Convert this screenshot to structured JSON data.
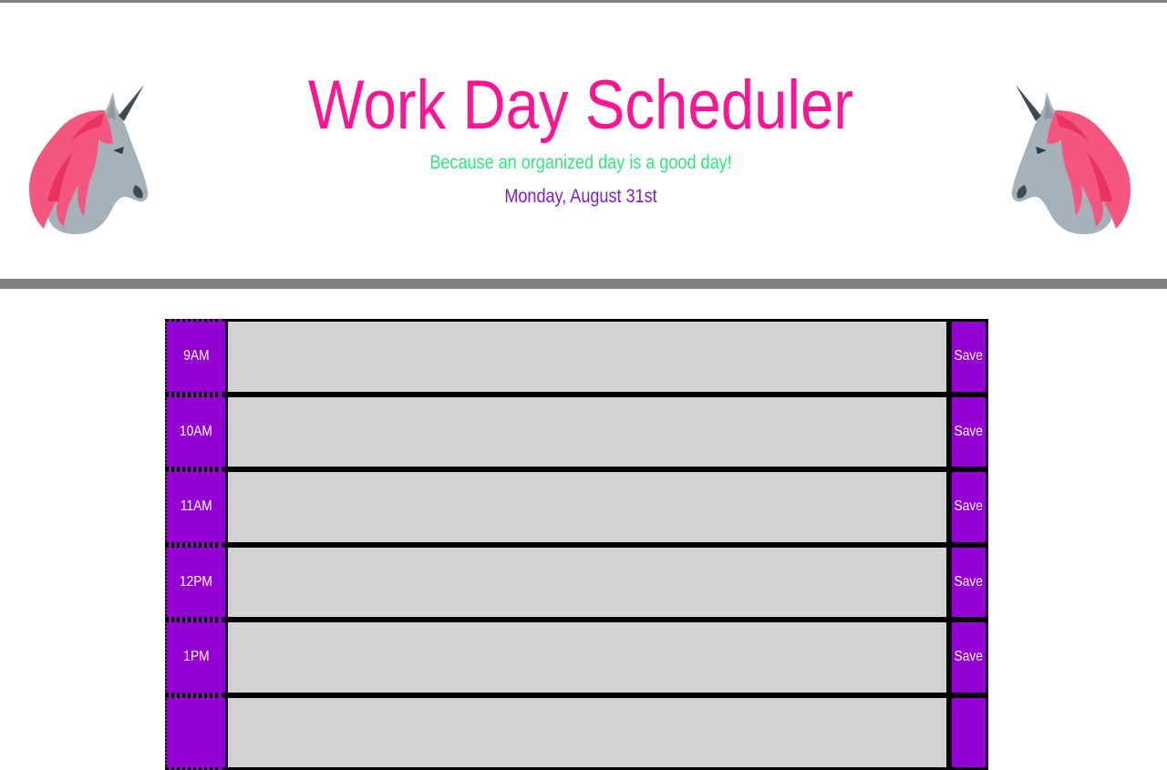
{
  "header": {
    "title": "Work Day Scheduler",
    "tagline": "Because an organized day is a good day!",
    "current_day": "Monday, August 31st"
  },
  "colors": {
    "title": "#ff1493",
    "tagline": "#2ee87b",
    "date": "#7b1fcf",
    "hour_block": "#9400d3",
    "save_button": "#9400d3",
    "description": "#d3d3d3",
    "rule": "#808080"
  },
  "icons": {
    "header_left": "unicorn-icon",
    "header_right": "unicorn-icon"
  },
  "timeblocks": [
    {
      "hour": "9AM",
      "text": "",
      "save_label": "Save"
    },
    {
      "hour": "10AM",
      "text": "",
      "save_label": "Save"
    },
    {
      "hour": "11AM",
      "text": "",
      "save_label": "Save"
    },
    {
      "hour": "12PM",
      "text": "",
      "save_label": "Save"
    },
    {
      "hour": "1PM",
      "text": "",
      "save_label": "Save"
    }
  ]
}
